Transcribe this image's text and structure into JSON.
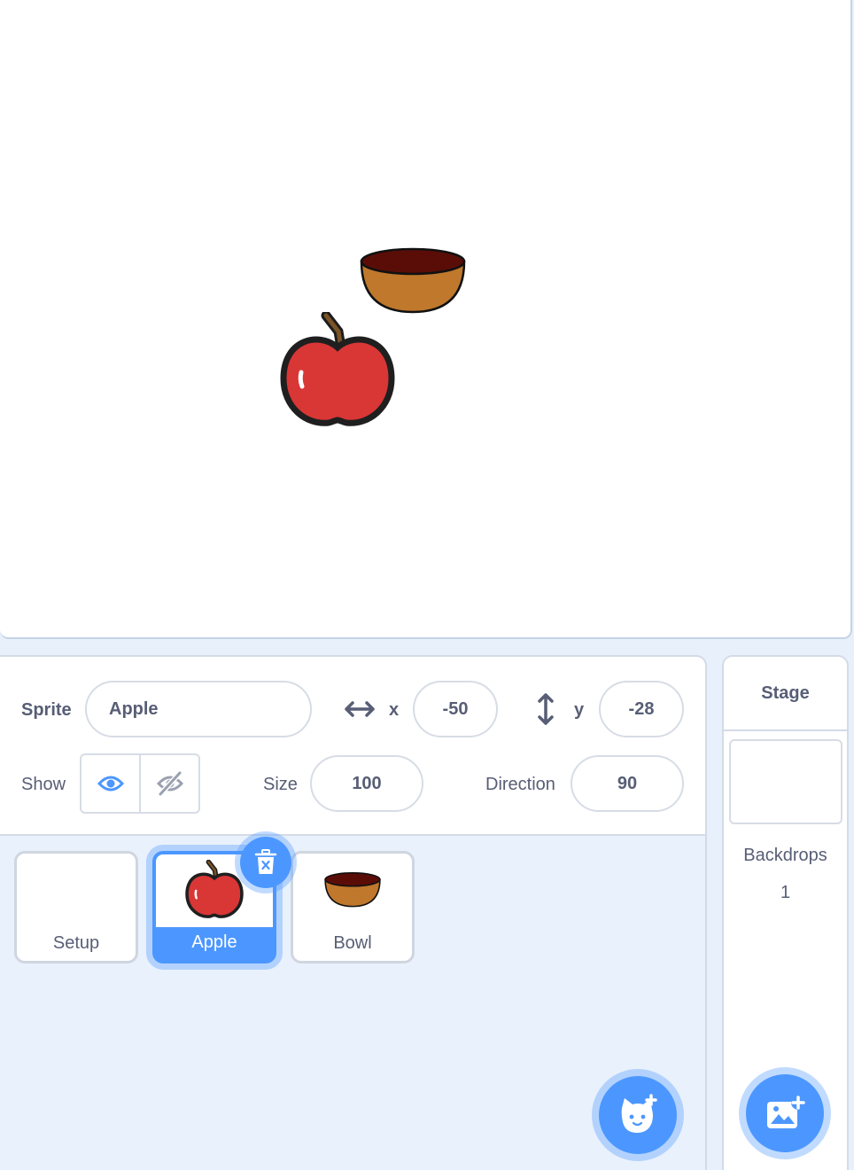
{
  "stage": {
    "sprites": [
      {
        "name": "bowl",
        "icon": "bowl-sprite"
      },
      {
        "name": "apple",
        "icon": "apple-sprite"
      }
    ]
  },
  "sprite_info": {
    "sprite_label": "Sprite",
    "sprite_name": "Apple",
    "x_label": "x",
    "x_value": "-50",
    "y_label": "y",
    "y_value": "-28",
    "show_label": "Show",
    "size_label": "Size",
    "size_value": "100",
    "direction_label": "Direction",
    "direction_value": "90"
  },
  "sprite_list": [
    {
      "name": "Setup",
      "selected": false
    },
    {
      "name": "Apple",
      "selected": true
    },
    {
      "name": "Bowl",
      "selected": false
    }
  ],
  "stage_selector": {
    "title": "Stage",
    "backdrops_label": "Backdrops",
    "backdrops_count": "1"
  },
  "colors": {
    "accent": "#4c97ff",
    "text": "#575e75",
    "apple_red": "#d93636",
    "bowl_orange": "#bf782c",
    "bowl_inner": "#5a0d07"
  }
}
